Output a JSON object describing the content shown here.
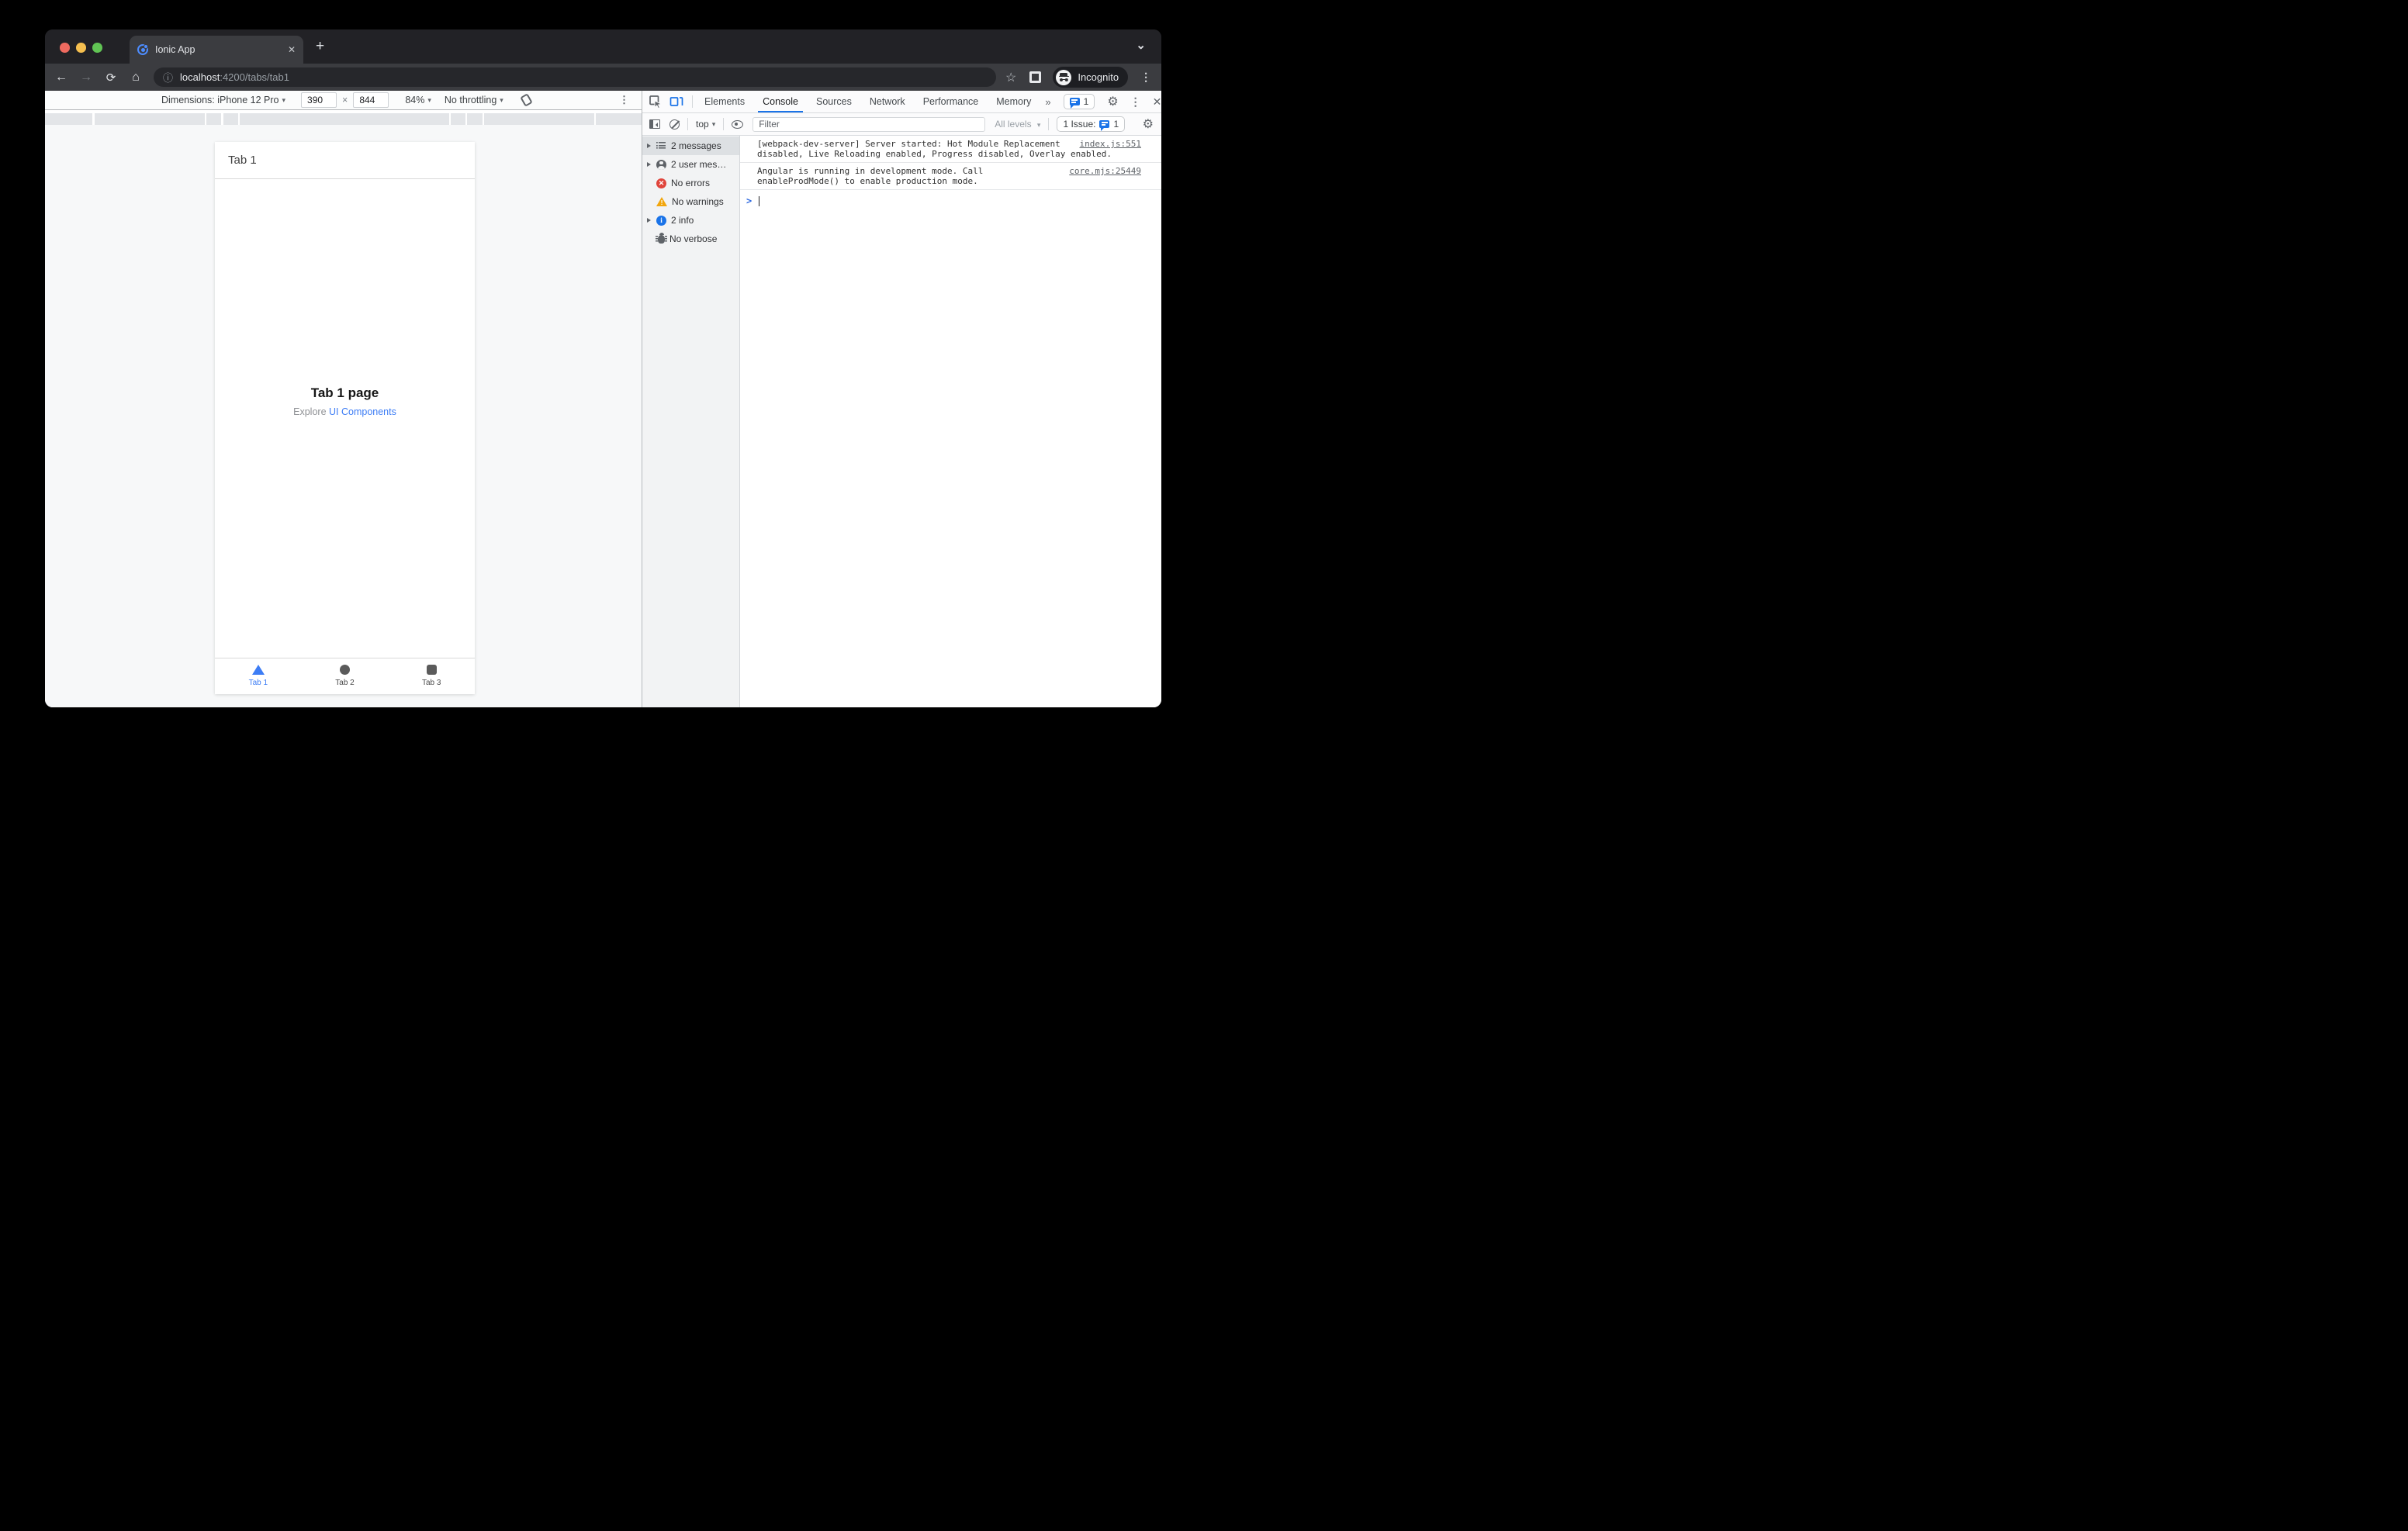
{
  "icons": {
    "back": "←",
    "forward": "→",
    "reload": "⟳",
    "home": "⌂",
    "site_info": "ⓘ",
    "bookmark_star": "☆",
    "menu_kebab": "⋮",
    "tab_close": "✕",
    "new_tab": "+",
    "window_chevron": "⌄",
    "dropdown_caret": "▾",
    "more_tabs": "»",
    "settings_gear": "⚙",
    "devtools_close": "✕",
    "prompt_chevron": ">",
    "error_x": "✕",
    "warning_mark": "!",
    "info_mark": "i",
    "dimensions_x": "×"
  },
  "browser": {
    "tab_title": "Ionic App",
    "url_host": "localhost",
    "url_rest": ":4200/tabs/tab1",
    "incognito_label": "Incognito"
  },
  "device_toolbar": {
    "dimensions_label": "Dimensions: iPhone 12 Pro",
    "width_value": "390",
    "height_value": "844",
    "zoom_value": "84%",
    "throttle_value": "No throttling"
  },
  "app": {
    "header_title": "Tab 1",
    "page_title": "Tab 1 page",
    "subtitle_prefix": "Explore ",
    "subtitle_link": "UI Components",
    "tabs": [
      {
        "label": "Tab 1",
        "icon": "triangle",
        "active": true
      },
      {
        "label": "Tab 2",
        "icon": "ellipse",
        "active": false
      },
      {
        "label": "Tab 3",
        "icon": "square",
        "active": false
      }
    ]
  },
  "devtools": {
    "tabs": [
      "Elements",
      "Console",
      "Sources",
      "Network",
      "Performance",
      "Memory"
    ],
    "active_tab": "Console",
    "message_badge_count": "1",
    "toolbar": {
      "context": "top",
      "filter_placeholder": "Filter",
      "levels_label": "All levels",
      "issues_label": "1 Issue:",
      "issues_count": "1"
    },
    "sidebar": [
      {
        "label": "2 messages",
        "icon": "list-icon",
        "expandable": true,
        "selected": true
      },
      {
        "label": "2 user mes…",
        "icon": "user-icon",
        "expandable": true,
        "selected": false
      },
      {
        "label": "No errors",
        "icon": "error-icon",
        "expandable": false,
        "selected": false
      },
      {
        "label": "No warnings",
        "icon": "warning-icon",
        "expandable": false,
        "selected": false
      },
      {
        "label": "2 info",
        "icon": "info-icon",
        "expandable": true,
        "selected": false
      },
      {
        "label": "No verbose",
        "icon": "verbose-bug-icon",
        "expandable": false,
        "selected": false
      }
    ],
    "messages": [
      {
        "text": "[webpack-dev-server] Server started: Hot Module Replacement disabled, Live Reloading enabled, Progress disabled, Overlay enabled.",
        "source": "index.js:551"
      },
      {
        "text": "Angular is running in development mode. Call enableProdMode() to enable production mode.",
        "source": "core.mjs:25449"
      }
    ]
  },
  "colors": {
    "devtools_accent": "#1a73e8",
    "ionic_blue": "#3d7df5",
    "error_red": "#e0453c",
    "warning_amber": "#f2a60d",
    "info_blue": "#1a73e8",
    "incognito_pill_bg": "#1d1e22",
    "toolbar_dark": "#3b3c40",
    "tabstrip_dark": "#222226"
  }
}
